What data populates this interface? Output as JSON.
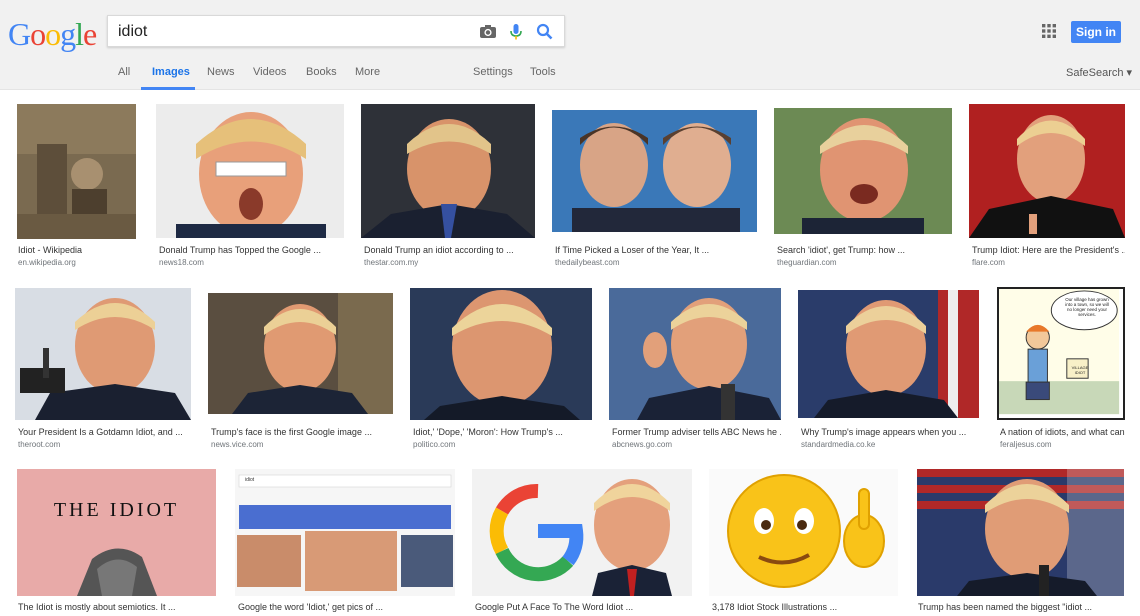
{
  "search": {
    "query": "idiot"
  },
  "logo": {
    "letters": [
      "G",
      "o",
      "o",
      "g",
      "l",
      "e"
    ],
    "colors": [
      "#4285f4",
      "#ea4335",
      "#fbbc05",
      "#4285f4",
      "#34a853",
      "#ea4335"
    ]
  },
  "header": {
    "signin_label": "Sign in"
  },
  "tabs": [
    {
      "label": "All"
    },
    {
      "label": "Images"
    },
    {
      "label": "News"
    },
    {
      "label": "Videos"
    },
    {
      "label": "Books"
    },
    {
      "label": "More"
    },
    {
      "label": "Settings"
    },
    {
      "label": "Tools"
    }
  ],
  "safesearch": "SafeSearch",
  "results": [
    {
      "caption": "Idiot - Wikipedia",
      "source": "en.wikipedia.org"
    },
    {
      "caption": "Donald Trump has Topped the Google ...",
      "source": "news18.com"
    },
    {
      "caption": "Donald Trump an idiot according to ...",
      "source": "thestar.com.my"
    },
    {
      "caption": "If Time Picked a Loser of the Year, It ...",
      "source": "thedailybeast.com"
    },
    {
      "caption": "Search 'idiot', get Trump: how ...",
      "source": "theguardian.com"
    },
    {
      "caption": "Trump Idiot: Here are the President's ...",
      "source": "flare.com"
    },
    {
      "caption": "Your President Is a Gotdamn Idiot, and ...",
      "source": "theroot.com"
    },
    {
      "caption": "Trump's face is the first Google image ...",
      "source": "news.vice.com"
    },
    {
      "caption": "Idiot,' 'Dope,' 'Moron': How Trump's ...",
      "source": "politico.com"
    },
    {
      "caption": "Former Trump adviser tells ABC News he ...",
      "source": "abcnews.go.com"
    },
    {
      "caption": "Why Trump's image appears when you ...",
      "source": "standardmedia.co.ke"
    },
    {
      "caption": "A nation of idiots, and what can ...",
      "source": "feraljesus.com"
    },
    {
      "caption": "The Idiot is mostly about semiotics. It ...",
      "source": ""
    },
    {
      "caption": "Google the word 'Idiot,' get pics of ...",
      "source": ""
    },
    {
      "caption": "Google Put A Face To The Word Idiot ...",
      "source": ""
    },
    {
      "caption": "3,178 Idiot Stock Illustrations ...",
      "source": ""
    },
    {
      "caption": "Trump has been named the biggest \"idiot ...",
      "source": ""
    }
  ],
  "images": {
    "the_idiot_title": "THE IDIOT",
    "mini_search_query": "idiot",
    "speech_bubble": "Our village has grown into a town, so we will no longer need your services.",
    "village_idiot": "VILLAGE IDIOT"
  }
}
